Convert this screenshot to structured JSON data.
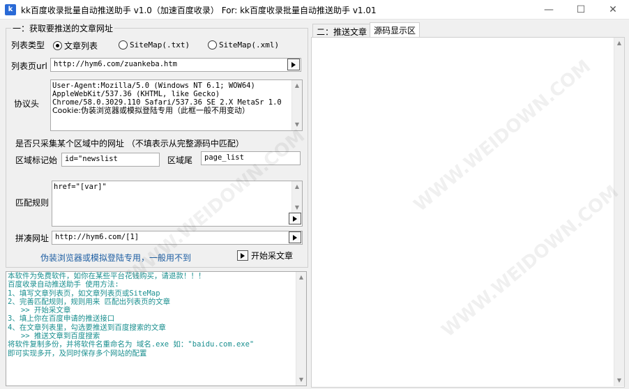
{
  "window": {
    "title": "kk百度收录批量自动推送助手 v1.0（加速百度收录） For: kk百度收录批量自动推送助手 v1.01",
    "minimize": "—",
    "maximize": "☐",
    "close": "✕"
  },
  "group1": {
    "title": "一：获取要推送的文章网址",
    "list_type_label": "列表类型",
    "radio_options": [
      "文章列表",
      "SiteMap(.txt)",
      "SiteMap(.xml)"
    ],
    "list_url_label": "列表页url",
    "list_url_value": "http://hym6.com/zuankeba.htm",
    "protocol_label": "协议头",
    "protocol_lines": [
      "User-Agent:Mozilla/5.0 (Windows NT 6.1; WOW64)",
      "AppleWebKit/537.36 (KHTML, like Gecko)",
      "Chrome/58.0.3029.110 Safari/537.36 SE 2.X MetaSr 1.0",
      "Cookie:伪装浏览器或模拟登陆专用（此框一般不用变动）"
    ],
    "region_question": "是否只采集某个区域中的网址 （不填表示从完整源码中匹配）",
    "region_start_label": "区域标记始",
    "region_start_value": "id=\"newslist",
    "region_end_label": "区域尾",
    "region_end_value": "page_list",
    "match_label": "匹配规则",
    "match_value": "href=\"[var]\"",
    "concat_label": "拼凑网址",
    "concat_value": "http://hym6.com/[1]",
    "hint": "伪装浏览器或模拟登陆专用，一般用不到",
    "start_button": "开始采文章"
  },
  "log_lines": [
    "本软件为免费软件，如你在某些平台花钱购买，请退款！！！",
    "百度收录自动推送助手 使用方法:",
    "",
    "1、填写文章列表页，如文章列表页或SiteMap",
    "2、完善匹配规则，规则用来 匹配出列表页的文章",
    "   >> 开始采文章",
    "3、填上你在百度申请的推送接口",
    "4、在文章列表里，勾选要推送到百度搜索的文章",
    "   >> 推送文章到百度搜索",
    "",
    "",
    "将软件复制多份，并将软件名重命名为 域名.exe 如：\"baidu.com.exe\"",
    "即可实现多开，及同时保存多个网站的配置"
  ],
  "tabs": [
    "二：推送文章",
    "源码显示区"
  ],
  "watermark_text": "WWW.WEIDOWN.COM"
}
